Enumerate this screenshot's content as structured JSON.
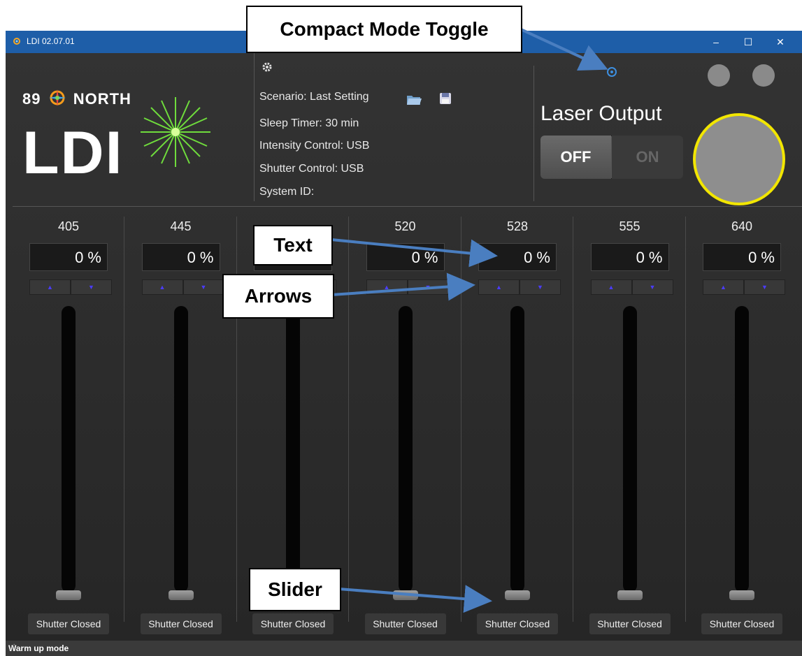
{
  "window": {
    "title": "LDI 02.07.01",
    "controls": [
      "–",
      "☐",
      "✕"
    ]
  },
  "logo": {
    "brand_left": "89",
    "brand_right": "NORTH",
    "product": "LDI"
  },
  "info": {
    "scenario": "Scenario: Last Setting",
    "sleep_timer": "Sleep Timer: 30 min",
    "intensity_control": "Intensity Control: USB",
    "shutter_control": "Shutter Control: USB",
    "system_id": "System ID:"
  },
  "laser": {
    "title": "Laser Output",
    "off_label": "OFF",
    "on_label": "ON",
    "state": "OFF",
    "ring_color": "#f2e600"
  },
  "channels": [
    {
      "label": "405",
      "value": "0 %",
      "shutter": "Shutter Closed",
      "level": 0
    },
    {
      "label": "445",
      "value": "0 %",
      "shutter": "Shutter Closed",
      "level": 0
    },
    {
      "label": "",
      "value": "",
      "shutter": "Shutter Closed",
      "level": 0
    },
    {
      "label": "520",
      "value": "0 %",
      "shutter": "Shutter Closed",
      "level": 0
    },
    {
      "label": "528",
      "value": "0 %",
      "shutter": "Shutter Closed",
      "level": 0
    },
    {
      "label": "555",
      "value": "0 %",
      "shutter": "Shutter Closed",
      "level": 0
    },
    {
      "label": "640",
      "value": "0 %",
      "shutter": "Shutter Closed",
      "level": 0
    }
  ],
  "arrow_glyphs": {
    "up": "▲",
    "down": "▼"
  },
  "status": "Warm up mode",
  "callouts": {
    "compact": "Compact Mode Toggle",
    "text": "Text",
    "arrows": "Arrows",
    "slider": "Slider"
  }
}
